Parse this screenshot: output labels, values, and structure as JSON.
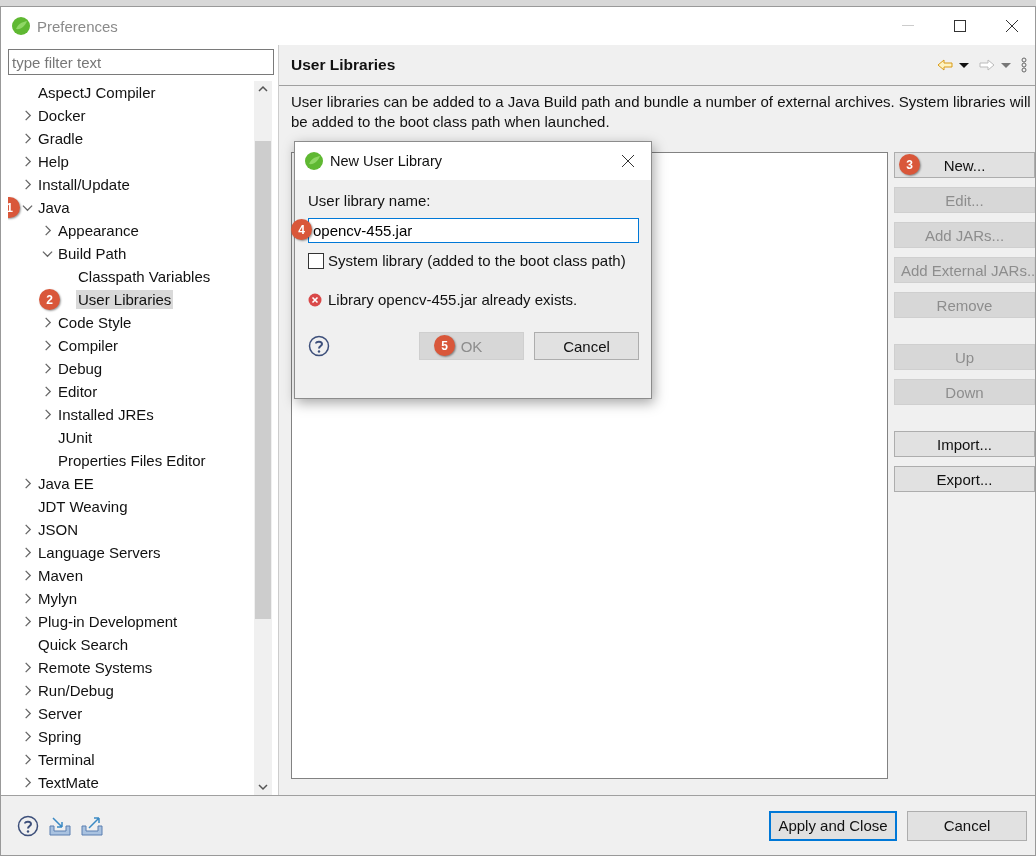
{
  "window": {
    "title": "Preferences"
  },
  "filter": {
    "placeholder": "type filter text"
  },
  "tree": [
    {
      "label": "AspectJ Compiler",
      "kind": "leaf",
      "selected": false
    },
    {
      "label": "Docker",
      "kind": "folder",
      "expanded": false,
      "selected": false
    },
    {
      "label": "Gradle",
      "kind": "folder",
      "expanded": false,
      "selected": false
    },
    {
      "label": "Help",
      "kind": "folder",
      "expanded": false,
      "selected": false
    },
    {
      "label": "Install/Update",
      "kind": "folder",
      "expanded": false,
      "selected": false
    },
    {
      "label": "Java",
      "kind": "folder",
      "expanded": true,
      "selected": false,
      "marker": "1",
      "children": [
        {
          "label": "Appearance",
          "kind": "folder",
          "expanded": false,
          "selected": false
        },
        {
          "label": "Build Path",
          "kind": "folder",
          "expanded": true,
          "selected": false,
          "children": [
            {
              "label": "Classpath Variables",
              "kind": "leaf",
              "selected": false
            },
            {
              "label": "User Libraries",
              "kind": "leaf",
              "selected": true,
              "marker": "2"
            }
          ]
        },
        {
          "label": "Code Style",
          "kind": "folder",
          "expanded": false,
          "selected": false
        },
        {
          "label": "Compiler",
          "kind": "folder",
          "expanded": false,
          "selected": false
        },
        {
          "label": "Debug",
          "kind": "folder",
          "expanded": false,
          "selected": false
        },
        {
          "label": "Editor",
          "kind": "folder",
          "expanded": false,
          "selected": false
        },
        {
          "label": "Installed JREs",
          "kind": "folder",
          "expanded": false,
          "selected": false
        },
        {
          "label": "JUnit",
          "kind": "leaf",
          "selected": false
        },
        {
          "label": "Properties Files Editor",
          "kind": "leaf",
          "selected": false
        }
      ]
    },
    {
      "label": "Java EE",
      "kind": "folder",
      "expanded": false,
      "selected": false
    },
    {
      "label": "JDT Weaving",
      "kind": "leaf",
      "selected": false
    },
    {
      "label": "JSON",
      "kind": "folder",
      "expanded": false,
      "selected": false
    },
    {
      "label": "Language Servers",
      "kind": "folder",
      "expanded": false,
      "selected": false
    },
    {
      "label": "Maven",
      "kind": "folder",
      "expanded": false,
      "selected": false
    },
    {
      "label": "Mylyn",
      "kind": "folder",
      "expanded": false,
      "selected": false
    },
    {
      "label": "Plug-in Development",
      "kind": "folder",
      "expanded": false,
      "selected": false
    },
    {
      "label": "Quick Search",
      "kind": "leaf",
      "selected": false
    },
    {
      "label": "Remote Systems",
      "kind": "folder",
      "expanded": false,
      "selected": false
    },
    {
      "label": "Run/Debug",
      "kind": "folder",
      "expanded": false,
      "selected": false
    },
    {
      "label": "Server",
      "kind": "folder",
      "expanded": false,
      "selected": false
    },
    {
      "label": "Spring",
      "kind": "folder",
      "expanded": false,
      "selected": false
    },
    {
      "label": "Terminal",
      "kind": "folder",
      "expanded": false,
      "selected": false
    },
    {
      "label": "TextMate",
      "kind": "folder",
      "expanded": false,
      "selected": false
    }
  ],
  "page": {
    "title": "User Libraries",
    "description": "User libraries can be added to a Java Build path and bundle a number of external archives. System libraries will be added to the boot class path when launched.",
    "button_groups": [
      [
        {
          "label": "New...",
          "disabled": false,
          "marker": "3"
        },
        {
          "label": "Edit...",
          "disabled": true
        },
        {
          "label": "Add JARs...",
          "disabled": true
        },
        {
          "label": "Add External JARs...",
          "disabled": true
        },
        {
          "label": "Remove",
          "disabled": true
        }
      ],
      [
        {
          "label": "Up",
          "disabled": true
        },
        {
          "label": "Down",
          "disabled": true
        }
      ],
      [
        {
          "label": "Import...",
          "disabled": false
        },
        {
          "label": "Export...",
          "disabled": false
        }
      ]
    ]
  },
  "dialog": {
    "title": "New User Library",
    "name_label": "User library name:",
    "name_value": "opencv-455.jar",
    "name_marker": "4",
    "system_library": {
      "label": "System library (added to the boot class path)",
      "checked": false
    },
    "error": "Library opencv-455.jar already exists.",
    "buttons": [
      {
        "label": "OK",
        "disabled": true,
        "marker": "5"
      },
      {
        "label": "Cancel",
        "disabled": false
      }
    ]
  },
  "footer": {
    "buttons": [
      {
        "label": "Apply and Close",
        "focused": true
      },
      {
        "label": "Cancel",
        "focused": false
      }
    ]
  }
}
